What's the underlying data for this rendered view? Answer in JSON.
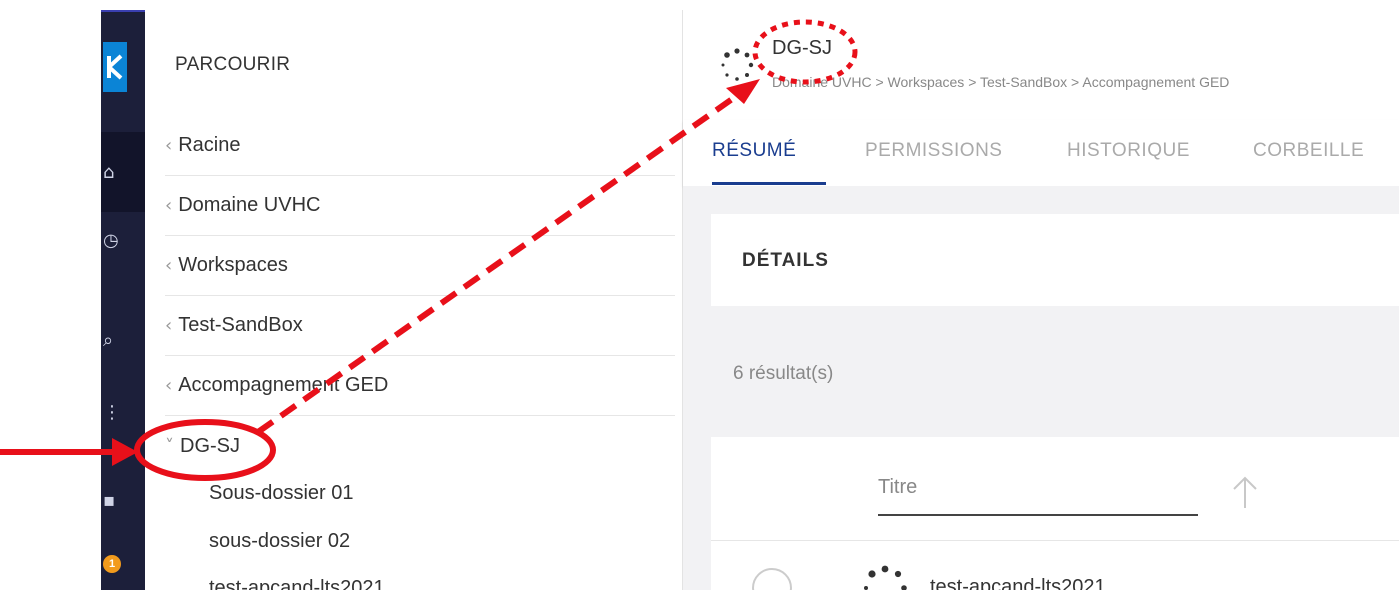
{
  "browse": {
    "title": "PARCOURIR",
    "crumbs": [
      {
        "label": "Racine"
      },
      {
        "label": "Domaine UVHC"
      },
      {
        "label": "Workspaces"
      },
      {
        "label": "Test-SandBox"
      },
      {
        "label": "Accompagnement GED"
      }
    ],
    "current": {
      "label": "DG-SJ"
    },
    "children": [
      {
        "label": "Sous-dossier 01"
      },
      {
        "label": "sous-dossier 02"
      },
      {
        "label": "test-apcand-lts2021"
      }
    ]
  },
  "rail": {
    "notification_count": "1",
    "icons": [
      "logo-icon",
      "home-icon",
      "clock-icon",
      "search-icon",
      "share-icon",
      "tasks-icon"
    ]
  },
  "header": {
    "title": "DG-SJ",
    "breadcrumb": "Domaine UVHC > Workspaces > Test-SandBox > Accompagnement GED"
  },
  "tabs": [
    {
      "label": "RÉSUMÉ",
      "active": true
    },
    {
      "label": "PERMISSIONS",
      "active": false
    },
    {
      "label": "HISTORIQUE",
      "active": false
    },
    {
      "label": "CORBEILLE",
      "active": false
    }
  ],
  "details": {
    "title": "DÉTAILS"
  },
  "results": {
    "count_text": "6 résultat(s)"
  },
  "table": {
    "column_title": "Titre",
    "rows": [
      {
        "title": "test-apcand-lts2021"
      }
    ]
  },
  "colors": {
    "rail_bg": "#1c1f3a",
    "accent": "#1a3d8f",
    "logo_blue": "#0b84d6",
    "badge_orange": "#f29b1d",
    "annotation_red": "#e8101a"
  }
}
